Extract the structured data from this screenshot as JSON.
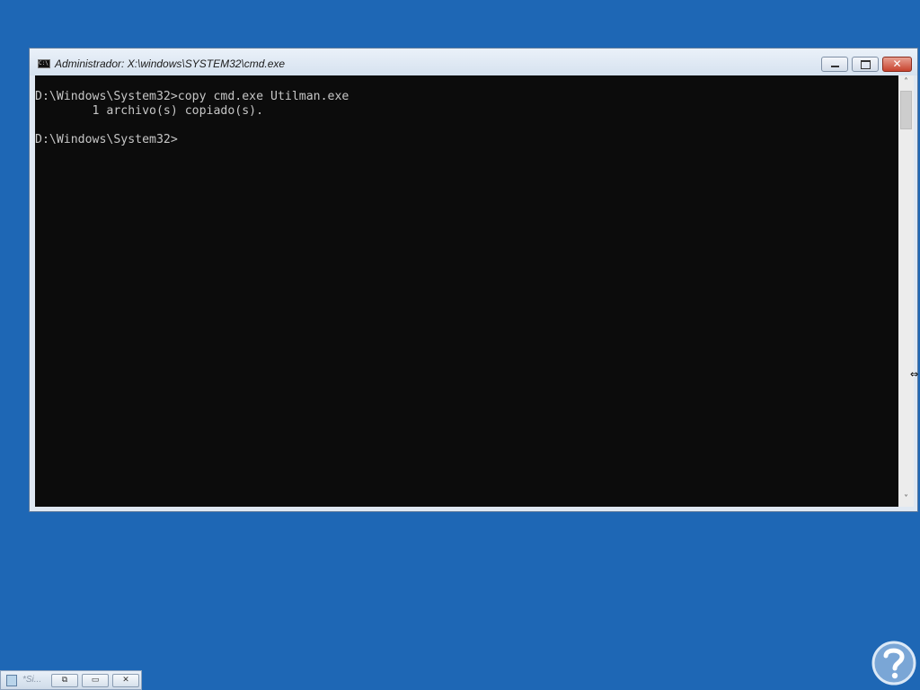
{
  "window": {
    "title": "Administrador: X:\\windows\\SYSTEM32\\cmd.exe",
    "icon": "console-icon",
    "icon_text": "C:\\",
    "controls": {
      "minimize": "minimize-icon",
      "maximize": "maximize-icon",
      "close_glyph": "✕"
    }
  },
  "console": {
    "background": "#0c0c0c",
    "foreground": "#c6c6c6",
    "lines": [
      "D:\\Windows\\System32>copy cmd.exe Utilman.exe",
      "        1 archivo(s) copiado(s).",
      "",
      "D:\\Windows\\System32>"
    ]
  },
  "scrollbar": {
    "up_glyph": "˄",
    "down_glyph": "˅"
  },
  "minimized_window": {
    "label": "*Si...",
    "restore_glyph": "⧉",
    "maximize_glyph": "▭",
    "close_glyph": "✕"
  },
  "desktop": {
    "background": "#1e67b5"
  }
}
